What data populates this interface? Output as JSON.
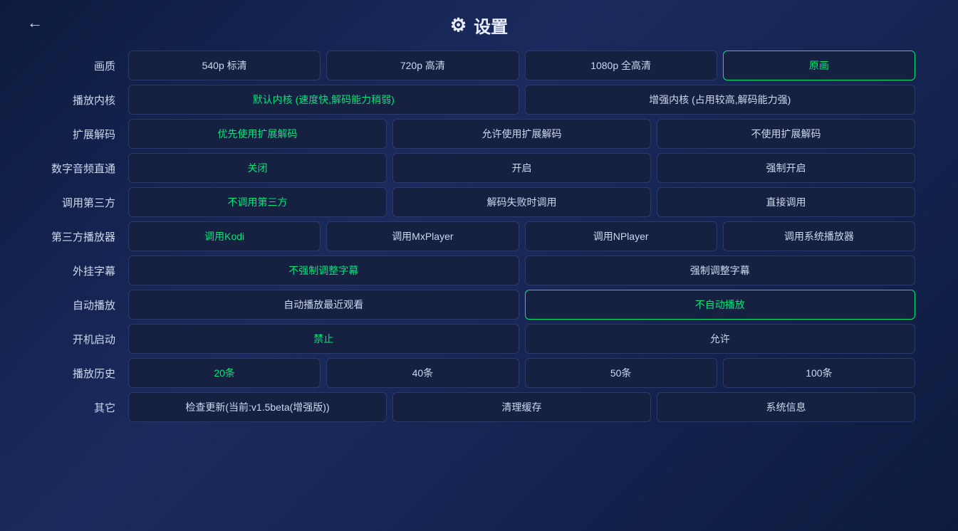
{
  "header": {
    "back_label": "←",
    "gear_symbol": "⚙",
    "title": "设置"
  },
  "rows": [
    {
      "id": "quality",
      "label": "画质",
      "buttons": [
        {
          "id": "q540",
          "text": "540p 标清",
          "state": "normal"
        },
        {
          "id": "q720",
          "text": "720p 高清",
          "state": "normal"
        },
        {
          "id": "q1080",
          "text": "1080p 全高清",
          "state": "normal"
        },
        {
          "id": "qoriginal",
          "text": "原画",
          "state": "active-green-border"
        }
      ]
    },
    {
      "id": "core",
      "label": "播放内核",
      "buttons": [
        {
          "id": "core-default",
          "text": "默认内核 (速度快,解码能力稍弱)",
          "state": "active-green"
        },
        {
          "id": "core-enhanced",
          "text": "增强内核 (占用较高,解码能力强)",
          "state": "normal"
        }
      ]
    },
    {
      "id": "ext-decode",
      "label": "扩展解码",
      "buttons": [
        {
          "id": "ext-prefer",
          "text": "优先使用扩展解码",
          "state": "active-green"
        },
        {
          "id": "ext-allow",
          "text": "允许使用扩展解码",
          "state": "normal"
        },
        {
          "id": "ext-no",
          "text": "不使用扩展解码",
          "state": "normal"
        }
      ]
    },
    {
      "id": "audio-passthrough",
      "label": "数字音频直通",
      "buttons": [
        {
          "id": "apt-off",
          "text": "关闭",
          "state": "active-green"
        },
        {
          "id": "apt-on",
          "text": "开启",
          "state": "normal"
        },
        {
          "id": "apt-force",
          "text": "强制开启",
          "state": "normal"
        }
      ]
    },
    {
      "id": "third-party",
      "label": "调用第三方",
      "buttons": [
        {
          "id": "tp-no",
          "text": "不调用第三方",
          "state": "active-green"
        },
        {
          "id": "tp-fail",
          "text": "解码失败时调用",
          "state": "normal"
        },
        {
          "id": "tp-direct",
          "text": "直接调用",
          "state": "normal"
        }
      ]
    },
    {
      "id": "third-player",
      "label": "第三方播放器",
      "buttons": [
        {
          "id": "player-kodi",
          "text": "调用Kodi",
          "state": "active-green"
        },
        {
          "id": "player-mxplayer",
          "text": "调用MxPlayer",
          "state": "normal"
        },
        {
          "id": "player-nplayer",
          "text": "调用NPlayer",
          "state": "normal"
        },
        {
          "id": "player-sys",
          "text": "调用系统播放器",
          "state": "normal"
        }
      ]
    },
    {
      "id": "subtitle",
      "label": "外挂字幕",
      "buttons": [
        {
          "id": "sub-no-force",
          "text": "不强制调整字幕",
          "state": "active-green"
        },
        {
          "id": "sub-force",
          "text": "强制调整字幕",
          "state": "normal"
        }
      ]
    },
    {
      "id": "autoplay",
      "label": "自动播放",
      "buttons": [
        {
          "id": "ap-recent",
          "text": "自动播放最近观看",
          "state": "normal"
        },
        {
          "id": "ap-no",
          "text": "不自动播放",
          "state": "active-green-border"
        }
      ]
    },
    {
      "id": "startup",
      "label": "开机启动",
      "buttons": [
        {
          "id": "st-forbid",
          "text": "禁止",
          "state": "active-green"
        },
        {
          "id": "st-allow",
          "text": "允许",
          "state": "normal"
        }
      ]
    },
    {
      "id": "history",
      "label": "播放历史",
      "buttons": [
        {
          "id": "h20",
          "text": "20条",
          "state": "active-green"
        },
        {
          "id": "h40",
          "text": "40条",
          "state": "normal"
        },
        {
          "id": "h50",
          "text": "50条",
          "state": "normal"
        },
        {
          "id": "h100",
          "text": "100条",
          "state": "normal"
        }
      ]
    },
    {
      "id": "other",
      "label": "其它",
      "buttons": [
        {
          "id": "check-update",
          "text": "检查更新(当前:v1.5beta(增强版))",
          "state": "normal"
        },
        {
          "id": "clear-cache",
          "text": "清理缓存",
          "state": "normal"
        },
        {
          "id": "sys-info",
          "text": "系统信息",
          "state": "normal"
        }
      ]
    }
  ]
}
